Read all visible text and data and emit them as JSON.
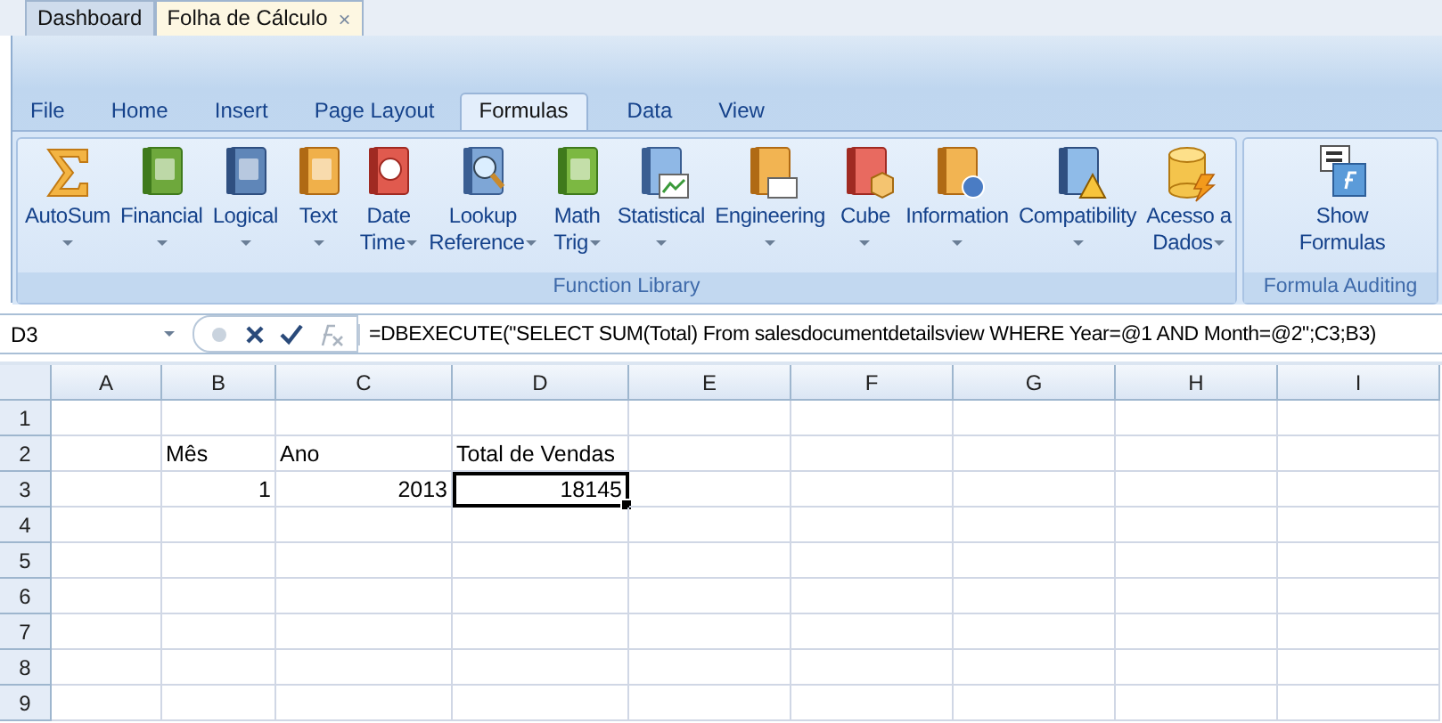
{
  "document_tabs": [
    {
      "label": "Dashboard",
      "selected": false
    },
    {
      "label": "Folha de Cálculo",
      "selected": true,
      "close": "×"
    }
  ],
  "ribbon": {
    "tabs": [
      {
        "label": "File",
        "selected": false
      },
      {
        "label": "Home",
        "selected": false
      },
      {
        "label": "Insert",
        "selected": false
      },
      {
        "label": "Page Layout",
        "selected": false
      },
      {
        "label": "Formulas",
        "selected": true
      },
      {
        "label": "Data",
        "selected": false
      },
      {
        "label": "View",
        "selected": false
      }
    ],
    "groups": [
      {
        "label": "Function Library",
        "buttons": [
          {
            "lines": [
              "AutoSum"
            ],
            "dropdown": true
          },
          {
            "lines": [
              "Financial"
            ],
            "dropdown": true
          },
          {
            "lines": [
              "Logical"
            ],
            "dropdown": true
          },
          {
            "lines": [
              "Text"
            ],
            "dropdown": true
          },
          {
            "lines": [
              "Date",
              "Time"
            ],
            "dropdown": true
          },
          {
            "lines": [
              "Lookup",
              "Reference"
            ],
            "dropdown": true
          },
          {
            "lines": [
              "Math",
              "Trig"
            ],
            "dropdown": true
          },
          {
            "lines": [
              "Statistical"
            ],
            "dropdown": true
          },
          {
            "lines": [
              "Engineering"
            ],
            "dropdown": true
          },
          {
            "lines": [
              "Cube"
            ],
            "dropdown": true
          },
          {
            "lines": [
              "Information"
            ],
            "dropdown": true
          },
          {
            "lines": [
              "Compatibility"
            ],
            "dropdown": true
          },
          {
            "lines": [
              "Acesso a",
              "Dados"
            ],
            "dropdown": true
          }
        ]
      },
      {
        "label": "Formula Auditing",
        "buttons": [
          {
            "lines": [
              "Show",
              "Formulas"
            ],
            "dropdown": false
          }
        ]
      }
    ]
  },
  "formula_bar": {
    "name_box": "D3",
    "formula": "=DBEXECUTE(\"SELECT SUM(Total) From salesdocumentdetailsview WHERE Year=@1 AND Month=@2\";C3;B3)"
  },
  "sheet": {
    "columns": [
      {
        "label": "A"
      },
      {
        "label": "B"
      },
      {
        "label": "C"
      },
      {
        "label": "D"
      },
      {
        "label": "E"
      },
      {
        "label": "F"
      },
      {
        "label": "G"
      },
      {
        "label": "H"
      },
      {
        "label": "I"
      }
    ],
    "rows": [
      {
        "label": "1"
      },
      {
        "label": "2",
        "cells": {
          "B": {
            "text": "Mês",
            "kind": "text",
            "selected": false
          },
          "C": {
            "text": "Ano",
            "kind": "text",
            "selected": false
          },
          "D": {
            "text": "Total de Vendas",
            "kind": "text",
            "selected": false
          }
        }
      },
      {
        "label": "3",
        "cells": {
          "B": {
            "text": "1",
            "kind": "number",
            "selected": false
          },
          "C": {
            "text": "2013",
            "kind": "number",
            "selected": false
          },
          "D": {
            "text": "18145",
            "kind": "number",
            "selected": true
          }
        }
      },
      {
        "label": "4"
      },
      {
        "label": "5"
      },
      {
        "label": "6"
      },
      {
        "label": "7"
      },
      {
        "label": "8"
      },
      {
        "label": "9"
      }
    ]
  }
}
